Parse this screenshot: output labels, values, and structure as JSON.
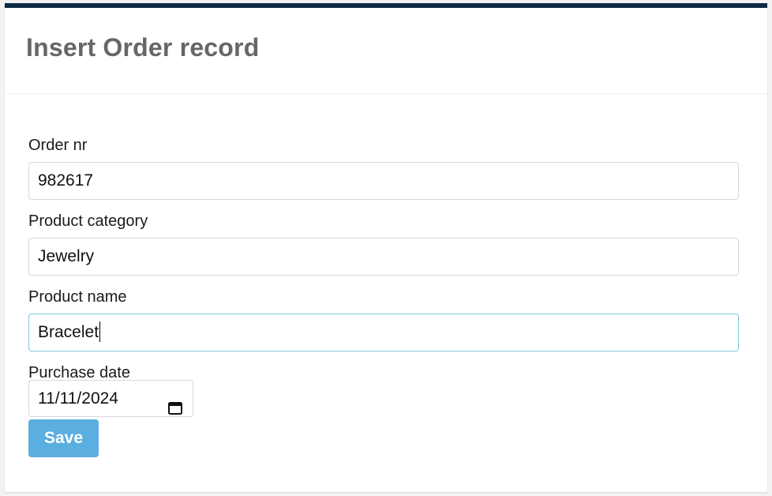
{
  "header": {
    "title": "Insert Order record"
  },
  "form": {
    "order_nr": {
      "label": "Order nr",
      "value": "982617"
    },
    "product_category": {
      "label": "Product category",
      "value": "Jewelry"
    },
    "product_name": {
      "label": "Product name",
      "value": "Bracelet"
    },
    "purchase_date": {
      "label": "Purchase date",
      "value": "11/11/2024"
    },
    "save_label": "Save"
  },
  "colors": {
    "top_bar": "#0e2a47",
    "button": "#5aaee0",
    "focus_border": "#7fc8d6"
  },
  "icons": {
    "date_picker": "calendar-icon"
  }
}
